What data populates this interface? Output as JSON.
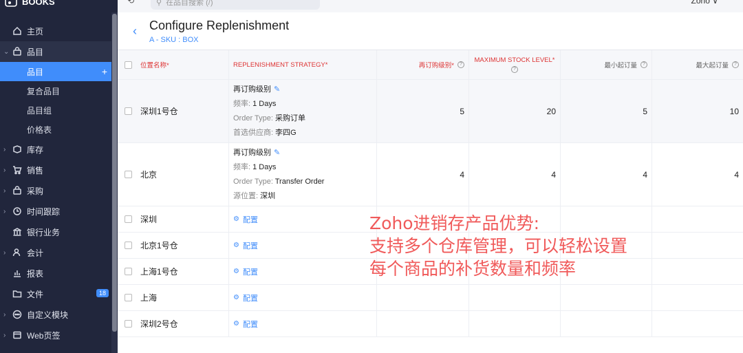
{
  "app": {
    "brand": "BOOKS",
    "org": "Zoho ∨"
  },
  "topbar": {
    "history_icon": "history-icon",
    "search_placeholder": "在品目搜索 (/)"
  },
  "sidebar": {
    "items": [
      {
        "label": "主页",
        "icon": "home-icon"
      },
      {
        "label": "品目",
        "icon": "bag-icon",
        "open": true
      },
      {
        "label": "库存",
        "icon": "box-icon"
      },
      {
        "label": "销售",
        "icon": "cart-icon"
      },
      {
        "label": "采购",
        "icon": "bag-icon"
      },
      {
        "label": "时间跟踪",
        "icon": "clock-icon"
      },
      {
        "label": "银行业务",
        "icon": "bank-icon"
      },
      {
        "label": "会计",
        "icon": "accounting-icon"
      },
      {
        "label": "报表",
        "icon": "chart-icon"
      },
      {
        "label": "文件",
        "icon": "folder-icon",
        "badge": "18"
      },
      {
        "label": "自定义模块",
        "icon": "dots-icon"
      },
      {
        "label": "Web页签",
        "icon": "web-icon"
      }
    ],
    "sub_items": [
      "品目",
      "复合品目",
      "品目组",
      "价格表"
    ]
  },
  "page": {
    "title": "Configure Replenishment",
    "subtitle": "A - SKU : BOX"
  },
  "table": {
    "headers": {
      "location": "位置名称*",
      "strategy": "REPLENISHMENT STRATEGY*",
      "reorder": "再订购级别*",
      "max_stock": "MAXIMUM STOCK LEVEL*",
      "min_order": "最小起订量",
      "max_order": "最大起订量"
    },
    "rows": [
      {
        "location": "深圳1号仓",
        "strategy": {
          "title": "再订购级别",
          "freq_label": "频率:",
          "freq": "1 Days",
          "type_label": "Order Type:",
          "type": "采购订单",
          "src_label": "首选供应商:",
          "src": "李四G"
        },
        "reorder": "5",
        "max_stock": "20",
        "min_order": "5",
        "max_order": "10"
      },
      {
        "location": "北京",
        "strategy": {
          "title": "再订购级别",
          "freq_label": "频率:",
          "freq": "1 Days",
          "type_label": "Order Type:",
          "type": "Transfer Order",
          "src_label": "源位置:",
          "src": "深圳"
        },
        "reorder": "4",
        "max_stock": "4",
        "min_order": "4",
        "max_order": "4"
      }
    ],
    "config_rows": [
      "深圳",
      "北京1号仓",
      "上海1号仓",
      "上海",
      "深圳2号仓"
    ],
    "config_label": "配置"
  },
  "overlay_text": "Zoho进销存产品优势:\n支持多个仓库管理，可以轻松设置\n每个商品的补货数量和频率"
}
